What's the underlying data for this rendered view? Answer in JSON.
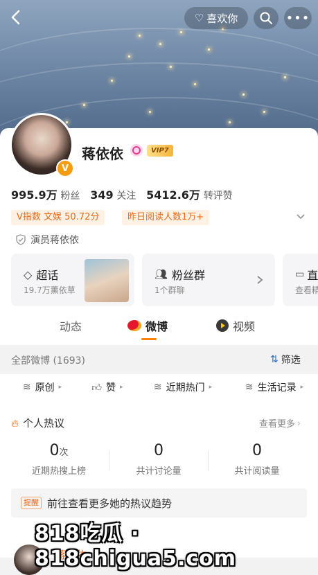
{
  "topbar": {
    "like_label": "喜欢你"
  },
  "profile": {
    "name": "蒋依依",
    "vip_label": "VIP7",
    "verify_badge": "V",
    "stats": [
      {
        "value": "995.9万",
        "label": "粉丝"
      },
      {
        "value": "349",
        "label": "关注"
      },
      {
        "value": "5412.6万",
        "label": "转评赞"
      }
    ],
    "tags": [
      "V指数 文娱 50.72分",
      "昨日阅读人数1万+"
    ],
    "certification": "演员蒋依依"
  },
  "tiles": [
    {
      "title": "超话",
      "sub": "19.7万薰依草"
    },
    {
      "title": "粉丝群",
      "sub": "1个群聊"
    },
    {
      "title": "直",
      "sub": "查看精"
    }
  ],
  "tabs": [
    {
      "label": "动态",
      "active": false
    },
    {
      "label": "微博",
      "active": true
    },
    {
      "label": "视频",
      "active": false
    }
  ],
  "filter": {
    "count_label": "全部微博 (1693)",
    "filter_label": "筛选"
  },
  "chips": [
    "原创",
    "赞",
    "近期热门",
    "生活记录"
  ],
  "hot": {
    "title": "个人热议",
    "more": "查看更多",
    "metrics": [
      {
        "value": "0",
        "unit": "次",
        "label": "近期热搜上榜"
      },
      {
        "value": "0",
        "unit": "",
        "label": "共计讨论量"
      },
      {
        "value": "0",
        "unit": "",
        "label": "共计阅读量"
      }
    ],
    "prompt_badge": "提醒",
    "prompt_text": "前往查看更多她的热议趋势"
  },
  "bottom_name": "蒋依依",
  "watermark": "818吃瓜 · 818chigua5.com",
  "colors": {
    "accent": "#ff8200",
    "tag_bg": "#fff1e3",
    "tag_text": "#e86b1b",
    "vip_gold": "#f4b53a"
  }
}
